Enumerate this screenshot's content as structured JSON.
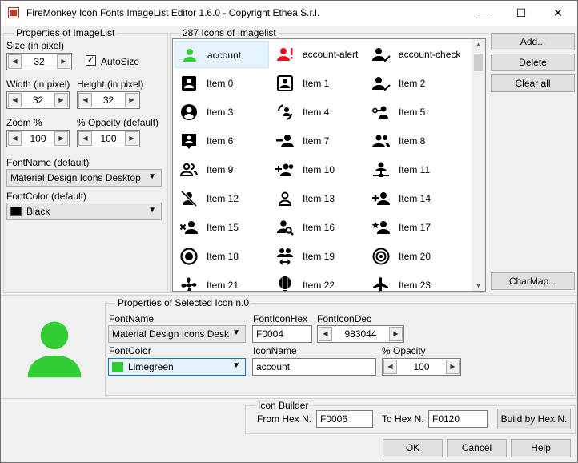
{
  "window": {
    "title": "FireMonkey Icon Fonts ImageList Editor 1.6.0 - Copyright Ethea S.r.l.",
    "minimize": "—",
    "maximize": "☐",
    "close": "✕"
  },
  "imagelist_props": {
    "group_title": "Properties of ImageList",
    "size_label": "Size (in pixel)",
    "size_value": "32",
    "autosize_label": "AutoSize",
    "autosize_checked": true,
    "width_label": "Width (in pixel)",
    "width_value": "32",
    "height_label": "Height (in pixel)",
    "height_value": "32",
    "zoom_label": "Zoom %",
    "zoom_value": "100",
    "opacity_label": "% Opacity (default)",
    "opacity_value": "100",
    "fontname_label": "FontName (default)",
    "fontname_value": "Material Design Icons Desktop",
    "fontcolor_label": "FontColor (default)",
    "fontcolor_value": "Black",
    "fontcolor_hex": "#000000"
  },
  "icons": {
    "group_title": "287 Icons of Imagelist",
    "items": [
      {
        "label": "account",
        "icon": "account-icon",
        "color": "#32cd32"
      },
      {
        "label": "account-alert",
        "icon": "account-alert-icon",
        "color": "#e81123"
      },
      {
        "label": "account-check",
        "icon": "account-check-icon",
        "color": "#000000"
      },
      {
        "label": "Item 0",
        "icon": "account-box-icon",
        "color": "#000000"
      },
      {
        "label": "Item 1",
        "icon": "account-box-outline-icon",
        "color": "#000000"
      },
      {
        "label": "Item 2",
        "icon": "account-check-icon",
        "color": "#000000"
      },
      {
        "label": "Item 3",
        "icon": "account-circle-icon",
        "color": "#000000"
      },
      {
        "label": "Item 4",
        "icon": "account-convert-icon",
        "color": "#000000"
      },
      {
        "label": "Item 5",
        "icon": "account-key-icon",
        "color": "#000000"
      },
      {
        "label": "Item 6",
        "icon": "account-location-icon",
        "color": "#000000"
      },
      {
        "label": "Item 7",
        "icon": "account-minus-icon",
        "color": "#000000"
      },
      {
        "label": "Item 8",
        "icon": "account-multiple-icon",
        "color": "#000000"
      },
      {
        "label": "Item 9",
        "icon": "account-multiple-outline-icon",
        "color": "#000000"
      },
      {
        "label": "Item 10",
        "icon": "account-multiple-plus-icon",
        "color": "#000000"
      },
      {
        "label": "Item 11",
        "icon": "account-network-icon",
        "color": "#000000"
      },
      {
        "label": "Item 12",
        "icon": "account-off-icon",
        "color": "#000000"
      },
      {
        "label": "Item 13",
        "icon": "account-outline-icon",
        "color": "#000000"
      },
      {
        "label": "Item 14",
        "icon": "account-plus-icon",
        "color": "#000000"
      },
      {
        "label": "Item 15",
        "icon": "account-remove-icon",
        "color": "#000000"
      },
      {
        "label": "Item 16",
        "icon": "account-search-icon",
        "color": "#000000"
      },
      {
        "label": "Item 17",
        "icon": "account-star-icon",
        "color": "#000000"
      },
      {
        "label": "Item 18",
        "icon": "record-circle-icon",
        "color": "#000000"
      },
      {
        "label": "Item 19",
        "icon": "account-switch-icon",
        "color": "#000000"
      },
      {
        "label": "Item 20",
        "icon": "target-icon",
        "color": "#000000"
      },
      {
        "label": "Item 21",
        "icon": "fan-icon",
        "color": "#000000"
      },
      {
        "label": "Item 22",
        "icon": "hot-air-balloon-icon",
        "color": "#000000"
      },
      {
        "label": "Item 23",
        "icon": "airplane-icon",
        "color": "#000000"
      }
    ]
  },
  "side_buttons": {
    "add": "Add...",
    "delete": "Delete",
    "clear_all": "Clear all",
    "charmap": "CharMap..."
  },
  "selected_icon": {
    "group_title": "Properties of Selected Icon n.0",
    "preview_icon": "account-icon",
    "preview_color": "#32cd32",
    "fontname_label": "FontName",
    "fontname_value": "Material Design Icons Desk",
    "fonticonhex_label": "FontIconHex",
    "fonticonhex_value": "F0004",
    "fonticondec_label": "FontIconDec",
    "fonticondec_value": "983044",
    "fontcolor_label": "FontColor",
    "fontcolor_value": "Limegreen",
    "fontcolor_hex": "#32cd32",
    "iconname_label": "IconName",
    "iconname_value": "account",
    "opacity_label": "% Opacity",
    "opacity_value": "100"
  },
  "icon_builder": {
    "group_title": "Icon Builder",
    "from_label": "From Hex N.",
    "from_value": "F0006",
    "to_label": "To Hex N.",
    "to_value": "F0120",
    "build_button": "Build by Hex N."
  },
  "footer": {
    "ok": "OK",
    "cancel": "Cancel",
    "help": "Help"
  }
}
